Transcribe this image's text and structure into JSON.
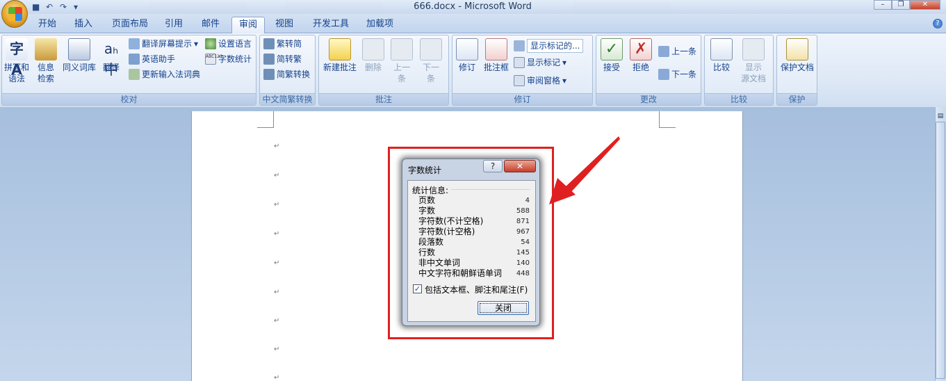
{
  "window": {
    "title": "666.docx - Microsoft Word"
  },
  "tabs": [
    "开始",
    "插入",
    "页面布局",
    "引用",
    "邮件",
    "审阅",
    "视图",
    "开发工具",
    "加载项"
  ],
  "active_tab": "审阅",
  "ribbon": {
    "proofing": {
      "label": "校对",
      "spelling": [
        "拼写和",
        "语法"
      ],
      "research": [
        "信息",
        "检索"
      ],
      "thesaurus": "同义词库",
      "translate": "翻译",
      "translate_tip": "翻译屏幕提示",
      "set_language": "设置语言",
      "english_assist": "英语助手",
      "word_count": "字数统计",
      "update_ime": "更新输入法词典"
    },
    "chinese": {
      "label": "中文简繁转换",
      "to_simplified": "繁转简",
      "to_traditional": "简转繁",
      "convert": "简繁转换"
    },
    "comments": {
      "label": "批注",
      "new": "新建批注",
      "delete": "删除",
      "prev": [
        "上一",
        "条"
      ],
      "next": [
        "下一",
        "条"
      ]
    },
    "tracking": {
      "label": "修订",
      "track": "修订",
      "balloons": "批注框",
      "display_dropdown": "显示标记的...",
      "show_markup": "显示标记",
      "reviewing_pane": "审阅窗格"
    },
    "changes": {
      "label": "更改",
      "accept": "接受",
      "reject": "拒绝",
      "previous": "上一条",
      "next": "下一条"
    },
    "compare": {
      "label": "比较",
      "compare": "比较",
      "show_source": [
        "显示",
        "源文档"
      ]
    },
    "protect": {
      "label": "保护",
      "protect_doc": "保护文档"
    }
  },
  "document": {
    "paragraph_mark": "↵"
  },
  "dialog": {
    "title": "字数统计",
    "help": "?",
    "section": "统计信息:",
    "stats": [
      {
        "label": "页数",
        "value": "4"
      },
      {
        "label": "字数",
        "value": "588"
      },
      {
        "label": "字符数(不计空格)",
        "value": "871"
      },
      {
        "label": "字符数(计空格)",
        "value": "967"
      },
      {
        "label": "段落数",
        "value": "54"
      },
      {
        "label": "行数",
        "value": "145"
      },
      {
        "label": "非中文单词",
        "value": "140"
      },
      {
        "label": "中文字符和朝鲜语单词",
        "value": "448"
      }
    ],
    "checkbox_label": "包括文本框、脚注和尾注(F)",
    "checkbox_checked": true,
    "close_label": "关闭"
  },
  "colors": {
    "highlight_box": "#e02020",
    "arrow": "#e02020"
  }
}
